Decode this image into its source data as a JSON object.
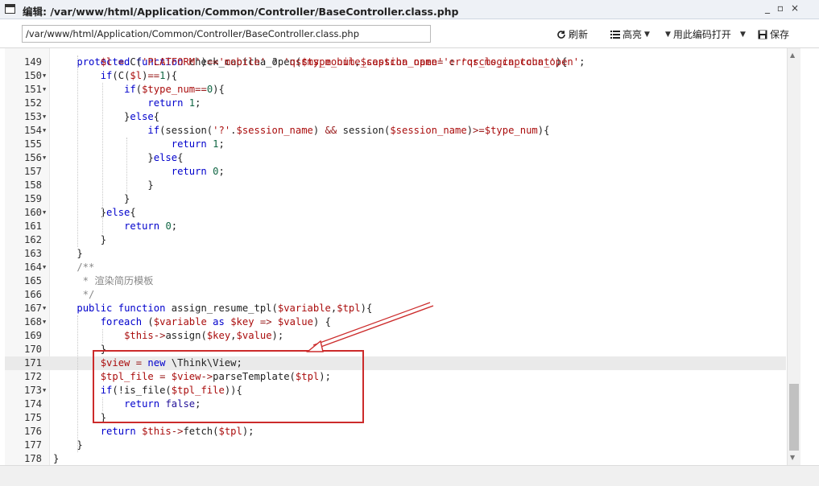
{
  "window": {
    "title": "编辑: /var/www/html/Application/Common/Controller/BaseController.class.php",
    "controls": [
      "_",
      "▫",
      "×"
    ]
  },
  "toolbar": {
    "path_value": "/var/www/html/Application/Common/Controller/BaseController.class.php",
    "refresh_label": "刷新",
    "highlight_label": "高亮",
    "open_with_encoding_label": "用此编码打开",
    "save_label": "保存"
  },
  "editor": {
    "active_line": 171,
    "lines": [
      {
        "num": "149",
        "fold": false
      },
      {
        "num": "150",
        "fold": true
      },
      {
        "num": "151",
        "fold": true
      },
      {
        "num": "152",
        "fold": false
      },
      {
        "num": "153",
        "fold": true
      },
      {
        "num": "154",
        "fold": true
      },
      {
        "num": "155",
        "fold": false
      },
      {
        "num": "156",
        "fold": true
      },
      {
        "num": "157",
        "fold": false
      },
      {
        "num": "158",
        "fold": false
      },
      {
        "num": "159",
        "fold": false
      },
      {
        "num": "160",
        "fold": true
      },
      {
        "num": "161",
        "fold": false
      },
      {
        "num": "162",
        "fold": false
      },
      {
        "num": "163",
        "fold": false
      },
      {
        "num": "164",
        "fold": true
      },
      {
        "num": "165",
        "fold": false
      },
      {
        "num": "166",
        "fold": false
      },
      {
        "num": "167",
        "fold": true
      },
      {
        "num": "168",
        "fold": true
      },
      {
        "num": "169",
        "fold": false
      },
      {
        "num": "170",
        "fold": false
      },
      {
        "num": "171",
        "fold": false
      },
      {
        "num": "172",
        "fold": false
      },
      {
        "num": "173",
        "fold": true
      },
      {
        "num": "174",
        "fold": false
      },
      {
        "num": "175",
        "fold": false
      },
      {
        "num": "176",
        "fold": false
      },
      {
        "num": "177",
        "fold": false
      },
      {
        "num": "178",
        "fold": false
      }
    ],
    "top_partial_line": "    protected function check_captcha_open($type_num,$session_name='error_login_count'){",
    "code": [
      "        $l = C('PLATFORM')=='mobile' ? 'qscms_mobile_captcha_open' : 'qscms_captcha_open';",
      "        if(C($l)==1){",
      "            if($type_num==0){",
      "                return 1;",
      "            }else{",
      "                if(session('?'.$session_name) && session($session_name)>=$type_num){",
      "                    return 1;",
      "                }else{",
      "                    return 0;",
      "                }",
      "            }",
      "        }else{",
      "            return 0;",
      "        }",
      "    }",
      "    /**",
      "     * 渲染简历模板",
      "     */",
      "    public function assign_resume_tpl($variable,$tpl){",
      "        foreach ($variable as $key => $value) {",
      "            $this->assign($key,$value);",
      "        }",
      "        $view = new \\Think\\View;",
      "        $tpl_file = $view->parseTemplate($tpl);",
      "        if(!is_file($tpl_file)){",
      "            return false;",
      "        }",
      "        return $this->fetch($tpl);",
      "    }",
      "}"
    ]
  },
  "icons": {
    "window": "window-icon",
    "refresh": "refresh-icon",
    "highlight": "list-icon",
    "open": "dropdown-icon",
    "save": "save-icon"
  },
  "colors": {
    "annotation": "#cc2b2b",
    "keyword": "#0000cc",
    "variable": "#aa0d0d",
    "string": "#aa1111",
    "number": "#116644"
  }
}
